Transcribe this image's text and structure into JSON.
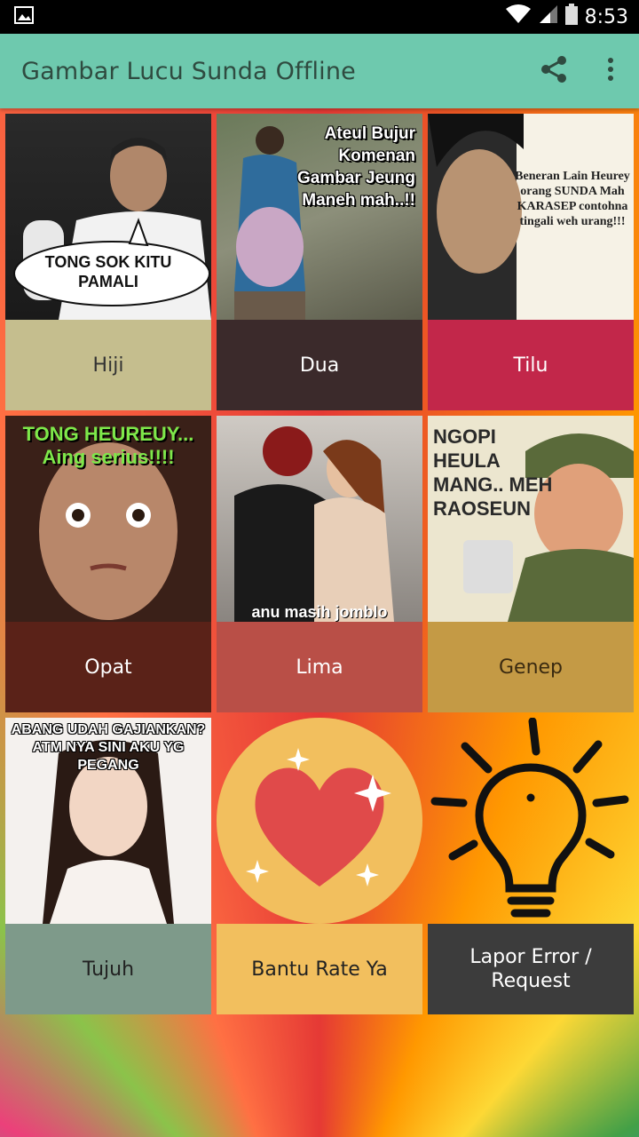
{
  "status_bar": {
    "time": "8:53",
    "icons": [
      "image-icon",
      "wifi-icon",
      "signal-icon",
      "battery-icon"
    ]
  },
  "app_bar": {
    "title": "Gambar Lucu Sunda Offline",
    "actions": [
      "share-icon",
      "overflow-menu-icon"
    ]
  },
  "colors": {
    "app_bar": "#6ec9ae",
    "status_bar": "#000000"
  },
  "cards": [
    {
      "label": "Hiji",
      "color": "#c5be8e",
      "text_color": "#333333",
      "caption": "TONG SOK KITU PAMALI"
    },
    {
      "label": "Dua",
      "color": "#3b2a2b",
      "text_color": "#ffffff",
      "caption": "Ateul Bujur Komenan Gambar Jeung Maneh mah..!!"
    },
    {
      "label": "Tilu",
      "color": "#c2274a",
      "text_color": "#ffffff",
      "caption": "Beneran Lain Heurey orang SUNDA Mah KARASEP contohna tingali weh urang!!!"
    },
    {
      "label": "Opat",
      "color": "#5a2218",
      "text_color": "#ffffff",
      "caption": "TONG HEUREUY... Aing serius!!!!"
    },
    {
      "label": "Lima",
      "color": "#b94f47",
      "text_color": "#ffffff",
      "caption": "anu masih jomblo"
    },
    {
      "label": "Genep",
      "color": "#c49a45",
      "text_color": "#3a2a10",
      "caption": "NGOPI HEULA MANG.. MEH RAOSEUN"
    },
    {
      "label": "Tujuh",
      "color": "#7e9a8a",
      "text_color": "#222222",
      "caption": "ABANG UDAH GAJIANKAN? ATM NYA SINI AKU YG PEGANG"
    },
    {
      "label": "Bantu Rate Ya",
      "color": "#f2bf5e",
      "text_color": "#222222",
      "caption": ""
    },
    {
      "label": "Lapor Error / Request",
      "color": "#3c3c3c",
      "text_color": "#ffffff",
      "caption": ""
    }
  ]
}
